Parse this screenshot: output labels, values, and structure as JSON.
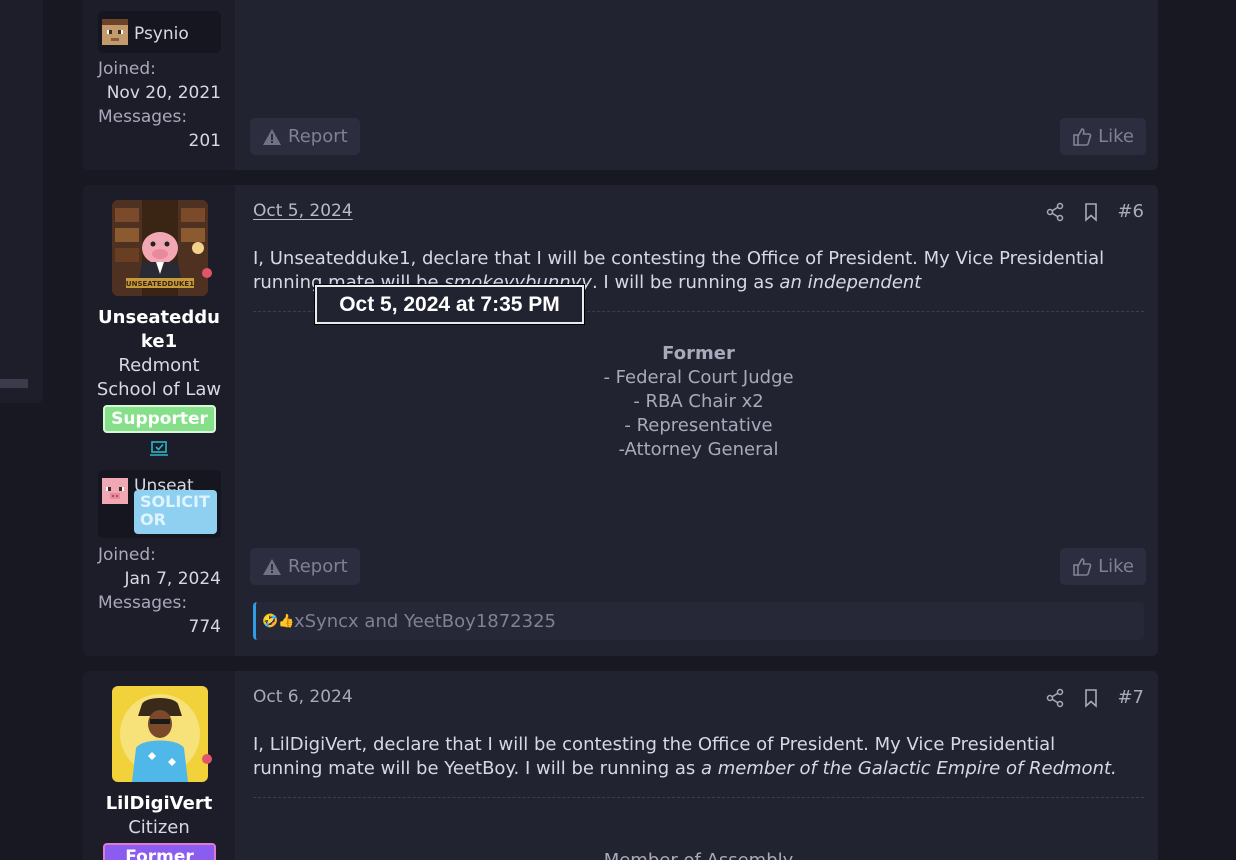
{
  "post_top": {
    "linked_account": "Psynio",
    "joined_label": "Joined:",
    "joined_value": "Nov 20, 2021",
    "messages_label": "Messages:",
    "messages_value": "201",
    "report_label": "Report",
    "like_label": "Like"
  },
  "post6": {
    "username": "Unseateddu ke1",
    "username_line1": "Unseateddu",
    "username_line2": "ke1",
    "avatar_caption": "UNSEATEDDUKE1",
    "title_line1": "Redmont",
    "title_line2": "School of Law",
    "banner": "Supporter",
    "linked_account": "Unseat",
    "linked_badge_line1": "SOLICIT",
    "linked_badge_line2": "OR",
    "joined_label": "Joined:",
    "joined_value": "Jan 7, 2024",
    "messages_label": "Messages:",
    "messages_value": "774",
    "date": "Oct 5, 2024",
    "post_number": "#6",
    "body_part1": "I, Unseatedduke1, declare that I will be contesting the Office of President. My Vice Presidential running mate will be ",
    "body_running_mate": "smokeyybunnyy",
    "body_part2": ". I will be running as ",
    "body_party": "an independent",
    "signature_heading": "Former",
    "signature_lines": [
      "- Federal Court Judge",
      "- RBA Chair x2",
      "- Representative",
      "-Attorney General"
    ],
    "report_label": "Report",
    "like_label": "Like",
    "reactions_emojis": "🤣👍",
    "reactions_text": "xSyncx and YeetBoy1872325"
  },
  "post7": {
    "username": "LilDigiVert",
    "title": "Citizen",
    "banner": "Former",
    "date": "Oct 6, 2024",
    "post_number": "#7",
    "body_part1": "I, LilDigiVert, declare that I will be contesting the Office of President. My Vice Presidential running mate will be YeetBoy. I will be running as ",
    "body_party": "a member of the Galactic Empire of Redmont.",
    "signature_partial": "Member of Assembly"
  },
  "tooltip": {
    "text": "Oct 5, 2024 at 7:35 PM"
  },
  "colors": {
    "supporter_banner": "#86e08a",
    "solicitor_badge": "#8fd0f0",
    "former_banner": "#8a5cf0",
    "reaction_accent": "#2f9be4",
    "online_dot": "#e0566a"
  }
}
